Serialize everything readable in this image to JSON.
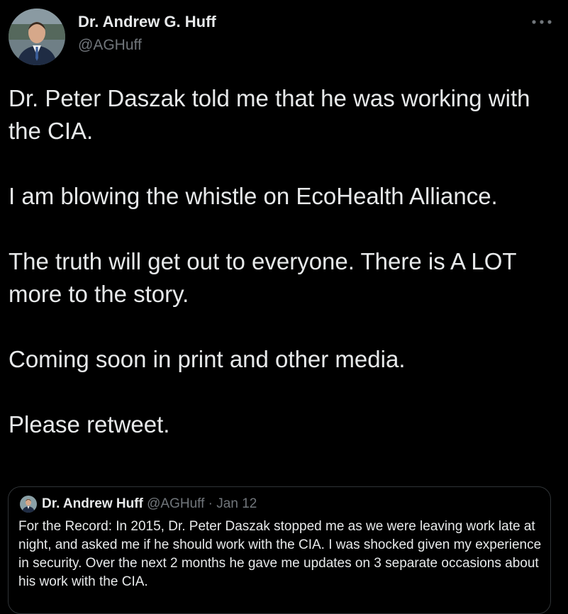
{
  "author": {
    "display_name": "Dr. Andrew G. Huff",
    "handle": "@AGHuff"
  },
  "more_icon": "more-horizontal-icon",
  "tweet": {
    "paragraphs": [
      "Dr. Peter Daszak told me that he was working with the CIA.",
      "I am blowing the whistle on EcoHealth Alliance.",
      "The truth will get out to everyone. There is A LOT more to the story.",
      "Coming soon in print and other media.",
      "Please retweet."
    ]
  },
  "quoted_tweet": {
    "display_name": "Dr. Andrew Huff",
    "handle": "@AGHuff",
    "separator": "·",
    "date": "Jan 12",
    "text": "For the Record: In 2015, Dr. Peter Daszak stopped me as we were leaving work late at night, and asked me if he should work with the CIA. I was shocked given my experience in security. Over the next 2 months he gave me updates on 3 separate occasions about his work with the CIA."
  },
  "colors": {
    "background": "#000000",
    "primary_text": "#e7e9ea",
    "secondary_text": "#71767b",
    "border": "#2f3336"
  }
}
